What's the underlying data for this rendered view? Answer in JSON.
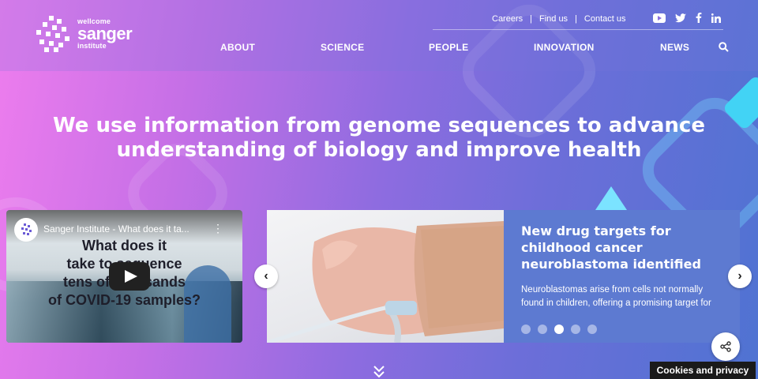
{
  "logo": {
    "line1": "wellcome",
    "line2": "sanger",
    "line3": "institute"
  },
  "top_links": [
    "Careers",
    "Find us",
    "Contact us"
  ],
  "socials": [
    "youtube-icon",
    "twitter-icon",
    "facebook-icon",
    "linkedin-icon"
  ],
  "nav": [
    "ABOUT",
    "SCIENCE",
    "PEOPLE",
    "INNOVATION",
    "NEWS"
  ],
  "hero": {
    "line1": "We use information from genome sequences to advance",
    "line2": "understanding of biology and improve health"
  },
  "video": {
    "channel_title": "Sanger Institute - What does it ta...",
    "lines": [
      "What does it",
      "take to sequence",
      "tens of thousands",
      "of COVID-19 samples?"
    ]
  },
  "carousel": {
    "title": "New drug targets for childhood cancer neuroblastoma identified",
    "description": "Neuroblastomas arise from cells not normally found in children, offering a promising target for drug development",
    "dot_count": 5,
    "active_dot": 2
  },
  "cookies": "Cookies and privacy",
  "colors": {
    "panel": "#5d7ad1",
    "gradient_start": "#ee7dee",
    "gradient_end": "#4f73d2"
  }
}
